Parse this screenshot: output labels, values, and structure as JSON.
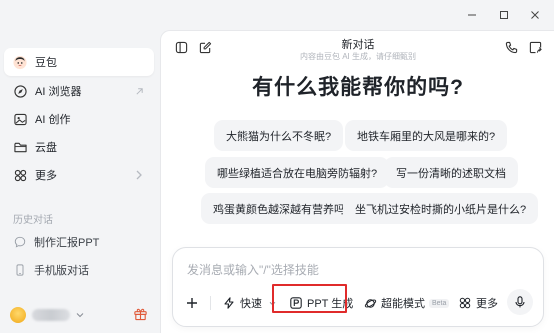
{
  "sidebar": {
    "items": [
      {
        "label": "豆包",
        "icon": "doubao-avatar-icon",
        "active": true
      },
      {
        "label": "AI 浏览器",
        "icon": "compass-icon",
        "trail": "external-arrow-icon"
      },
      {
        "label": "AI 创作",
        "icon": "image-icon"
      },
      {
        "label": "云盘",
        "icon": "folder-icon"
      },
      {
        "label": "更多",
        "icon": "grid-icon",
        "trail": "chevron-right-icon"
      }
    ],
    "history_title": "历史对话",
    "history": [
      {
        "label": "制作汇报PPT",
        "icon": "chat-bubble-icon"
      },
      {
        "label": "手机版对话",
        "icon": "phone-icon"
      }
    ]
  },
  "header": {
    "title": "新对话",
    "subtitle": "内容由豆包 AI 生成，请仔细甄别"
  },
  "main": {
    "hero": "有什么我能帮你的吗?",
    "suggestions": [
      "大熊猫为什么不冬眠?",
      "地铁车厢里的大风是哪来的?",
      "哪些绿植适合放在电脑旁防辐射?",
      "写一份清晰的述职文档",
      "鸡蛋黄颜色越深越有营养吗?",
      "坐飞机过安检时撕的小纸片是什么?"
    ]
  },
  "composer": {
    "placeholder": "发消息或输入\"/\"选择技能",
    "tools": {
      "fast": "快速",
      "ppt": "PPT 生成",
      "super": "超能模式",
      "beta": "Beta",
      "more": "更多"
    }
  },
  "colors": {
    "highlight": "#e02b2b",
    "sidebar_bg": "#f3f4f6",
    "chip_bg": "#f3f4f6"
  }
}
